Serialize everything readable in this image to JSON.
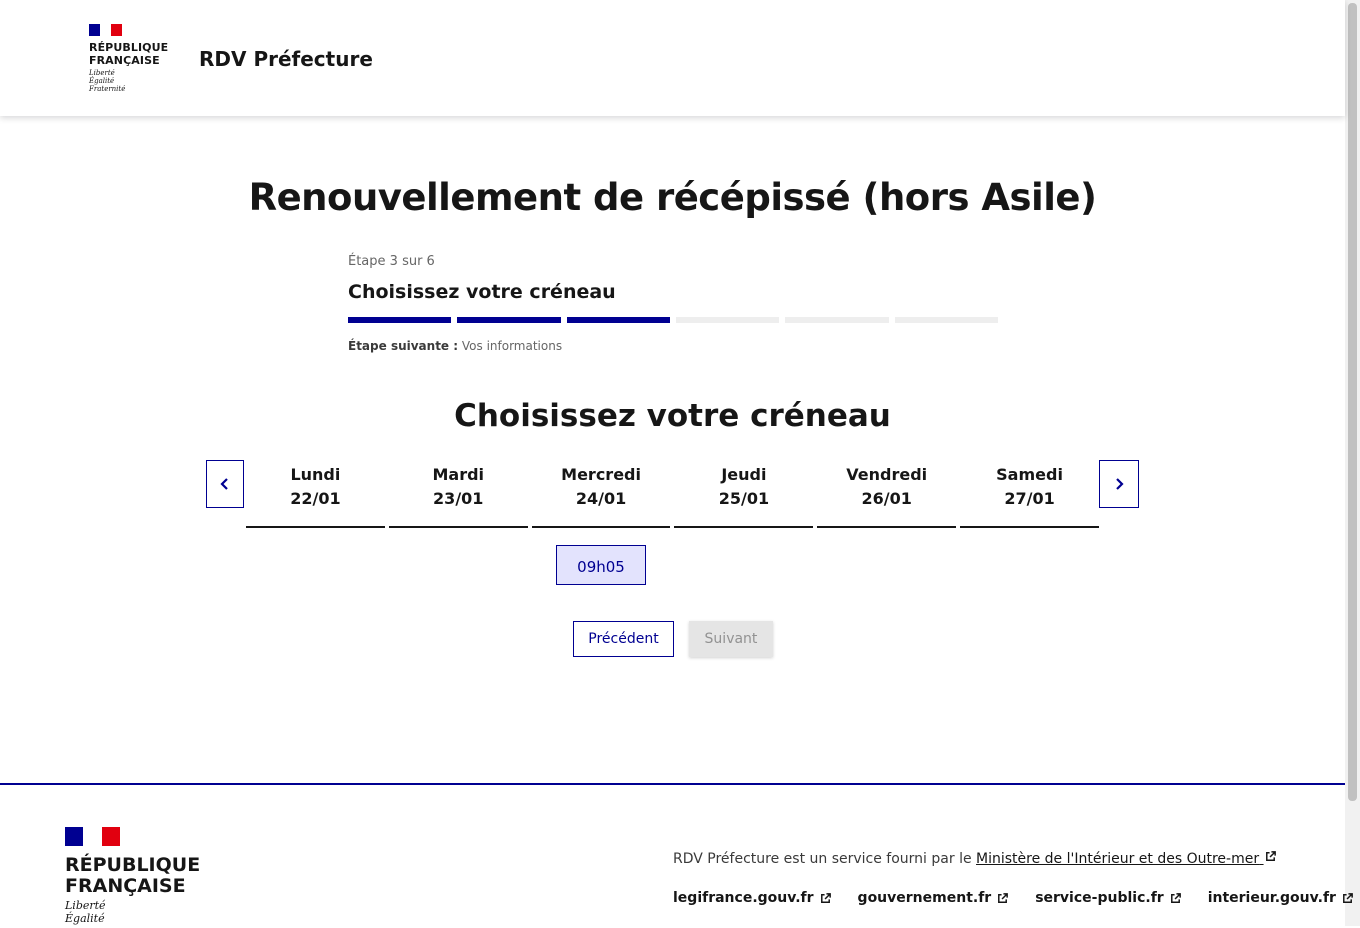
{
  "header": {
    "logo_lines": [
      "RÉPUBLIQUE",
      "FRANÇAISE"
    ],
    "motto": [
      "Liberté",
      "Égalité",
      "Fraternité"
    ],
    "service_title": "RDV Préfecture"
  },
  "colors": {
    "flag_blue": "#000091",
    "flag_white": "#ffffff",
    "flag_red": "#e1000f",
    "accent": "#000091",
    "slot_selected_bg": "#e3e3fd"
  },
  "main": {
    "page_title": "Renouvellement de récépissé (hors Asile)",
    "stepper": {
      "state": "Étape 3 sur 6",
      "current_step": 3,
      "total_steps": 6,
      "title": "Choisissez votre créneau",
      "next_label": "Étape suivante :",
      "next_value": "Vos informations"
    },
    "section_title": "Choisissez votre créneau",
    "prev_week_icon": "chevron-left-icon",
    "next_week_icon": "chevron-right-icon",
    "days": [
      {
        "name": "Lundi",
        "date": "22/01"
      },
      {
        "name": "Mardi",
        "date": "23/01"
      },
      {
        "name": "Mercredi",
        "date": "24/01"
      },
      {
        "name": "Jeudi",
        "date": "25/01"
      },
      {
        "name": "Vendredi",
        "date": "26/01"
      },
      {
        "name": "Samedi",
        "date": "27/01"
      }
    ],
    "slot": {
      "day": "Mercredi",
      "time": "09h05",
      "selected": true
    },
    "buttons": {
      "previous": "Précédent",
      "next": "Suivant"
    }
  },
  "footer": {
    "logo_lines": [
      "RÉPUBLIQUE",
      "FRANÇAISE"
    ],
    "motto": [
      "Liberté",
      "Égalité"
    ],
    "description_prefix": "RDV Préfecture est un service fourni par le",
    "description_link": "Ministère de l'Intérieur et des Outre-mer",
    "links": [
      "legifrance.gouv.fr",
      "gouvernement.fr",
      "service-public.fr",
      "interieur.gouv.fr"
    ]
  }
}
